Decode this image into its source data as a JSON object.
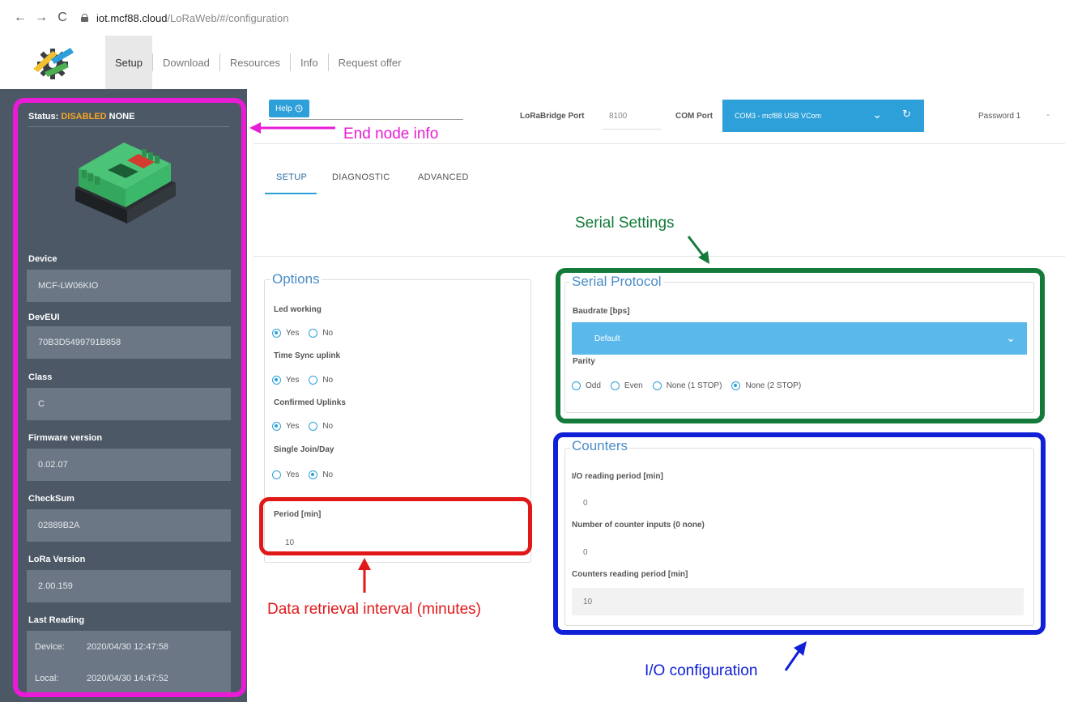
{
  "browser": {
    "back": "←",
    "forward": "→",
    "reload": "C",
    "url_host": "iot.mcf88.cloud",
    "url_path": "/LoRaWeb/#/configuration"
  },
  "menu": {
    "items": [
      "Setup",
      "Download",
      "Resources",
      "Info",
      "Request offer"
    ],
    "active": "Setup"
  },
  "sidebar": {
    "status_label": "Status:",
    "status_value": "DISABLED",
    "status_extra": "NONE",
    "fields": [
      {
        "label": "Device",
        "value": "MCF-LW06KIO"
      },
      {
        "label": "DevEUI",
        "value": "70B3D5499791B858"
      },
      {
        "label": "Class",
        "value": "C"
      },
      {
        "label": "Firmware version",
        "value": "0.02.07"
      },
      {
        "label": "CheckSum",
        "value": "02889B2A"
      },
      {
        "label": "LoRa Version",
        "value": "2.00.159"
      }
    ],
    "last_reading": {
      "label": "Last Reading",
      "device_label": "Device:",
      "device_value": "2020/04/30 12:47:58",
      "local_label": "Local:",
      "local_value": "2020/04/30 14:47:52"
    }
  },
  "controls": {
    "help": "Help",
    "lorabridge_label": "LoRaBridge Port",
    "lorabridge_value": "8100",
    "com_label": "COM Port",
    "com_value": "COM3 - mcf88 USB VCom",
    "password_label": "Password 1",
    "password_value": "-"
  },
  "tabs": [
    "SETUP",
    "DIAGNOSTIC",
    "ADVANCED"
  ],
  "options": {
    "legend": "Options",
    "groups": [
      {
        "label": "Led working",
        "choices": [
          "Yes",
          "No"
        ],
        "selected": "Yes"
      },
      {
        "label": "Time Sync uplink",
        "choices": [
          "Yes",
          "No"
        ],
        "selected": "Yes"
      },
      {
        "label": "Confirmed Uplinks",
        "choices": [
          "Yes",
          "No"
        ],
        "selected": "Yes"
      },
      {
        "label": "Single Join/Day",
        "choices": [
          "Yes",
          "No"
        ],
        "selected": "No"
      }
    ],
    "period_label": "Period [min]",
    "period_value": "10"
  },
  "serial": {
    "legend": "Serial Protocol",
    "baudrate_label": "Baudrate [bps]",
    "baudrate_value": "Default",
    "parity_label": "Parity",
    "parity_choices": [
      "Odd",
      "Even",
      "None (1 STOP)",
      "None (2 STOP)"
    ],
    "parity_selected": "None (2 STOP)"
  },
  "counters": {
    "legend": "Counters",
    "io_period_label": "I/O reading period [min]",
    "io_period_value": "0",
    "num_inputs_label": "Number of counter inputs (0 none)",
    "num_inputs_value": "0",
    "counter_period_label": "Counters reading period [min]",
    "counter_period_value": "10"
  },
  "annotations": {
    "end_node": "End node info",
    "serial_settings": "Serial Settings",
    "data_retrieval": "Data retrieval interval (minutes)",
    "io_config": "I/O configuration",
    "colors": {
      "magenta": "#ea1bd6",
      "green": "#137a3a",
      "red": "#e01818",
      "blue": "#1020d6"
    }
  },
  "colors": {
    "accent": "#2d9fd9",
    "sidebar": "#4c5866",
    "disabled": "#f5a623"
  }
}
